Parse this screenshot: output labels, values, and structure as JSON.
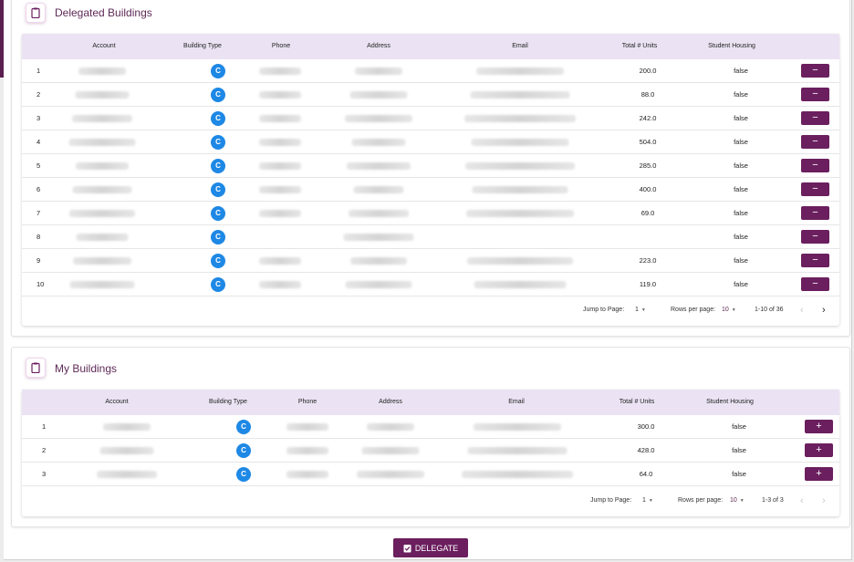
{
  "delegated": {
    "title": "Delegated Buildings",
    "headers": {
      "account": "Account",
      "building_type": "Building Type",
      "phone": "Phone",
      "address": "Address",
      "email": "Email",
      "units": "Total # Units",
      "student": "Student Housing"
    },
    "rows": [
      {
        "n": "1",
        "type": "C",
        "units": "200.0",
        "student": "false"
      },
      {
        "n": "2",
        "type": "C",
        "units": "88.0",
        "student": "false"
      },
      {
        "n": "3",
        "type": "C",
        "units": "242.0",
        "student": "false"
      },
      {
        "n": "4",
        "type": "C",
        "units": "504.0",
        "student": "false"
      },
      {
        "n": "5",
        "type": "C",
        "units": "285.0",
        "student": "false"
      },
      {
        "n": "6",
        "type": "C",
        "units": "400.0",
        "student": "false"
      },
      {
        "n": "7",
        "type": "C",
        "units": "69.0",
        "student": "false"
      },
      {
        "n": "8",
        "type": "C",
        "units": "",
        "student": "false"
      },
      {
        "n": "9",
        "type": "C",
        "units": "223.0",
        "student": "false"
      },
      {
        "n": "10",
        "type": "C",
        "units": "119.0",
        "student": "false"
      }
    ],
    "row_action": "−",
    "pager": {
      "jump_label": "Jump to Page:",
      "jump_value": "1",
      "rows_label": "Rows per page:",
      "rows_value": "10",
      "range": "1-10 of 36"
    }
  },
  "mine": {
    "title": "My Buildings",
    "headers": {
      "account": "Account",
      "building_type": "Building Type",
      "phone": "Phone",
      "address": "Address",
      "email": "Email",
      "units": "Total # Units",
      "student": "Student Housing"
    },
    "rows": [
      {
        "n": "1",
        "type": "C",
        "units": "300.0",
        "student": "false"
      },
      {
        "n": "2",
        "type": "C",
        "units": "428.0",
        "student": "false"
      },
      {
        "n": "3",
        "type": "C",
        "units": "64.0",
        "student": "false"
      }
    ],
    "row_action": "+",
    "pager": {
      "jump_label": "Jump to Page:",
      "jump_value": "1",
      "rows_label": "Rows per page:",
      "rows_value": "10",
      "range": "1-3 of 3"
    }
  },
  "delegate_button": "DELEGATE",
  "icons": {
    "section": "clipboard-icon",
    "delegate": "check-clipboard-icon",
    "next": "chevron-right-icon",
    "prev": "chevron-left-icon",
    "dropdown": "caret-down-icon"
  },
  "colors": {
    "primary": "#6b1f5f",
    "header_bg": "#ebe3f3",
    "tag_blue": "#1e88e5",
    "title": "#5e2a57"
  }
}
